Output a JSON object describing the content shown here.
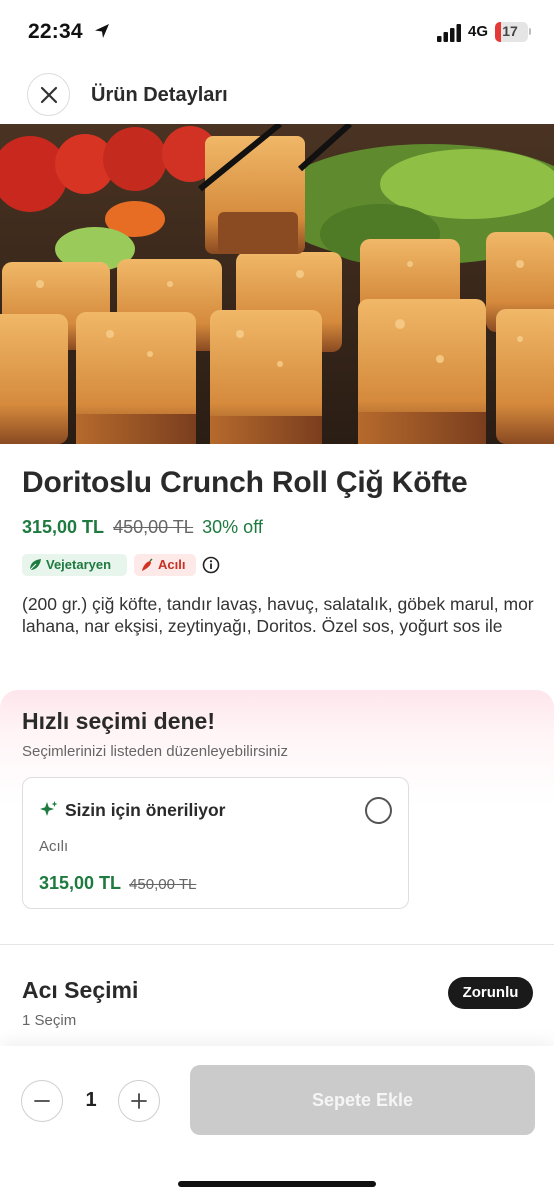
{
  "status_bar": {
    "time": "22:34",
    "network": "4G",
    "battery": "17",
    "icons": [
      "location-arrow-icon",
      "signal-icon",
      "battery-icon"
    ]
  },
  "header": {
    "title": "Ürün Detayları",
    "close_icon": "close-icon"
  },
  "product": {
    "title": "Doritoslu Crunch Roll Çiğ Köfte",
    "price": "315,00 TL",
    "old_price": "450,00 TL",
    "discount": "30% off",
    "badges": [
      {
        "label": "Vejetaryen",
        "icon": "leaf-icon",
        "color": "#1e7a3f"
      },
      {
        "label": "Acılı",
        "icon": "chili-pepper-icon",
        "color": "#c63324"
      }
    ],
    "info_icon": "info-icon",
    "description": "(200 gr.) çiğ köfte, tandır lavaş, havuç, salatalık, göbek marul, mor lahana, nar ekşisi, zeytinyağı, Doritos. Özel sos, yoğurt sos ile"
  },
  "quick_pick": {
    "title": "Hızlı seçimi dene!",
    "subtitle": "Seçimlerinizi listeden düzenleyebilirsiniz",
    "card": {
      "title": "Sizin için öneriliyor",
      "icon": "sparkle-icon",
      "option": "Acılı",
      "price": "315,00 TL",
      "old_price": "450,00 TL",
      "selected": false
    }
  },
  "spice_selection": {
    "title": "Acı Seçimi",
    "subtitle": "1 Seçim",
    "badge": "Zorunlu"
  },
  "bottom_bar": {
    "quantity": "1",
    "add_to_cart": "Sepete Ekle"
  },
  "colors": {
    "price_green": "#1e7a3f",
    "disabled_button": "#cbcbcb",
    "required_badge": "#1a1a1a"
  }
}
